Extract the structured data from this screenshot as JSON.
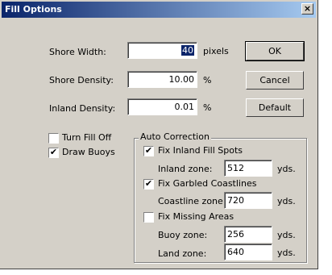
{
  "window": {
    "title": "Fill Options",
    "close_label": "×"
  },
  "shore_width": {
    "label": "Shore Width:",
    "value": "40",
    "unit": "pixels"
  },
  "shore_density": {
    "label": "Shore Density:",
    "value": "10.00",
    "unit": "%"
  },
  "inland_density": {
    "label": "Inland Density:",
    "value": "0.01",
    "unit": "%"
  },
  "buttons": {
    "ok": "OK",
    "cancel": "Cancel",
    "default": "Default"
  },
  "turn_fill_off": {
    "label": "Turn Fill Off",
    "checked": false
  },
  "draw_buoys": {
    "label": "Draw Buoys",
    "checked": true
  },
  "auto_correction": {
    "label": "Auto Correction",
    "fix_inland": {
      "label": "Fix Inland Fill Spots",
      "checked": true
    },
    "inland_zone": {
      "label": "Inland zone:",
      "value": "512",
      "unit": "yds."
    },
    "fix_garbled": {
      "label": "Fix Garbled Coastlines",
      "checked": true
    },
    "coastline_zone": {
      "label": "Coastline zone:",
      "value": "720",
      "unit": "yds."
    },
    "fix_missing": {
      "label": "Fix Missing Areas",
      "checked": false
    },
    "buoy_zone": {
      "label": "Buoy zone:",
      "value": "256",
      "unit": "yds."
    },
    "land_zone": {
      "label": "Land zone:",
      "value": "640",
      "unit": "yds."
    }
  },
  "checkmark": "✔"
}
